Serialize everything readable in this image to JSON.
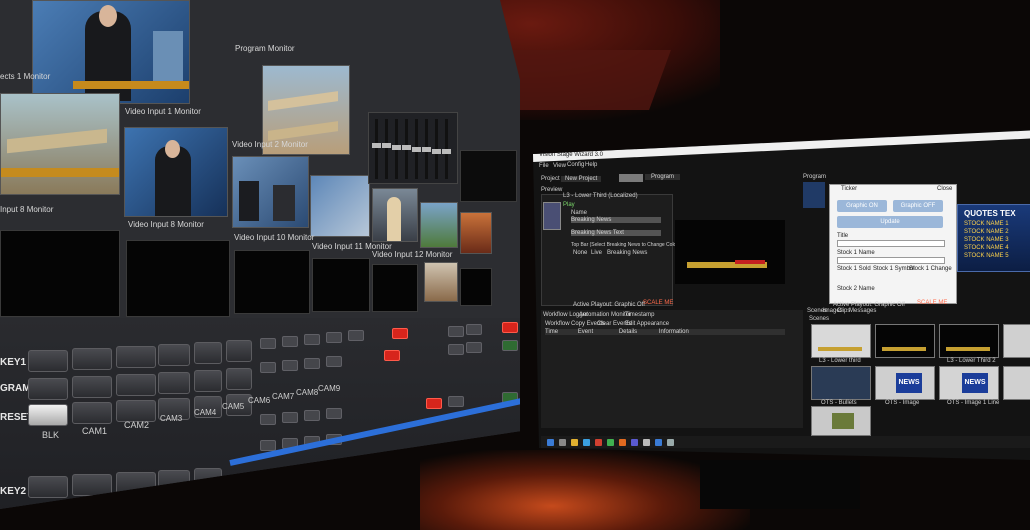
{
  "scene": {
    "left_monitor": {
      "monitors": {
        "effects_1": "ects 1 Monitor",
        "video_input_1": "Video Input 1 Monitor",
        "video_input_2": "Video Input 2 Monitor",
        "video_input_8": "Video Input 8 Monitor",
        "input_8": "Input 8 Monitor",
        "video_input_10": "Video Input 10 Monitor",
        "video_input_11": "Video Input 11 Monitor",
        "video_input_12": "Video Input 12 Monitor",
        "program": "Program Monitor"
      },
      "panel_rows": {
        "key1": "KEY1",
        "program": "GRAM",
        "preset": "RESET",
        "key2": "KEY2"
      },
      "button_labels": [
        "BLK",
        "CAM1",
        "CAM2",
        "CAM3",
        "CAM4",
        "CAM5",
        "CAM6",
        "CAM7",
        "CAM8",
        "CAM9"
      ]
    },
    "right_monitor": {
      "title": "Vision Stage Wizard 3.0",
      "menu": [
        "File",
        "View",
        "Config",
        "Help"
      ],
      "project_label": "Project",
      "project_value": "New Project",
      "program_tab": "Program",
      "preview_label": "Preview",
      "panel_left_title": "L3 - Lower Third (Localized)",
      "play": "Play",
      "name_label": "Name",
      "name_value": "Breaking News",
      "sub_value": "Breaking News Text",
      "bar_text": "Top Bar (Select Breaking News to Change Color of Bar)",
      "radio_options": [
        "None",
        "Live",
        "Breaking News"
      ],
      "status_left": "Active Playout: Graphic Off",
      "status_right": "SCALE ME",
      "program_window": "Program",
      "program_panel_title": "Ticker",
      "graphics_on": "Graphic ON",
      "graphics_off": "Graphic OFF",
      "update": "Update",
      "close": "Close",
      "fields": [
        "Title",
        "Stock 1 Name",
        "Stock 1 Sold",
        "Stock 1 Symbol",
        "Stock 1 Change",
        "Stock 2 Name"
      ],
      "quotes_title": "QUOTES TEX",
      "stock_rows": [
        "STOCK NAME 1",
        "STOCK NAME 2",
        "STOCK NAME 3",
        "STOCK NAME 4",
        "STOCK NAME 5"
      ],
      "tabs_bottom": [
        "Workflow Logger",
        "Automation Monitor",
        "Timestamp"
      ],
      "workflow_options": [
        "Workflow",
        "Copy Events",
        "Clear Events",
        "Edit Appearance"
      ],
      "workflow_columns": [
        "Time",
        "Event",
        "Details",
        "Information"
      ],
      "scenes_tabs": [
        "Scenes",
        "Images",
        "Clips",
        "Messages"
      ],
      "scenes_label": "Scenes",
      "scene_thumbs": [
        {
          "caption": "L3 - Lower third",
          "news": false
        },
        {
          "caption": "",
          "news": false
        },
        {
          "caption": "L3 - Lower Third 2",
          "news": false
        },
        {
          "caption": "",
          "news": false
        },
        {
          "caption": "OTS - Bullets",
          "news": false
        },
        {
          "caption": "OTS - Image",
          "news": true
        },
        {
          "caption": "OTS - Image 1 Line",
          "news": true
        },
        {
          "caption": "",
          "news": false
        },
        {
          "caption": "",
          "news": false
        }
      ],
      "news_word": "NEWS"
    }
  },
  "colors": {
    "room": "#0b0706",
    "switcher_body": "#2c2d31",
    "tally_red": "#d7251c",
    "app_dark": "#131313",
    "accent_blue": "#9bb7d9"
  }
}
